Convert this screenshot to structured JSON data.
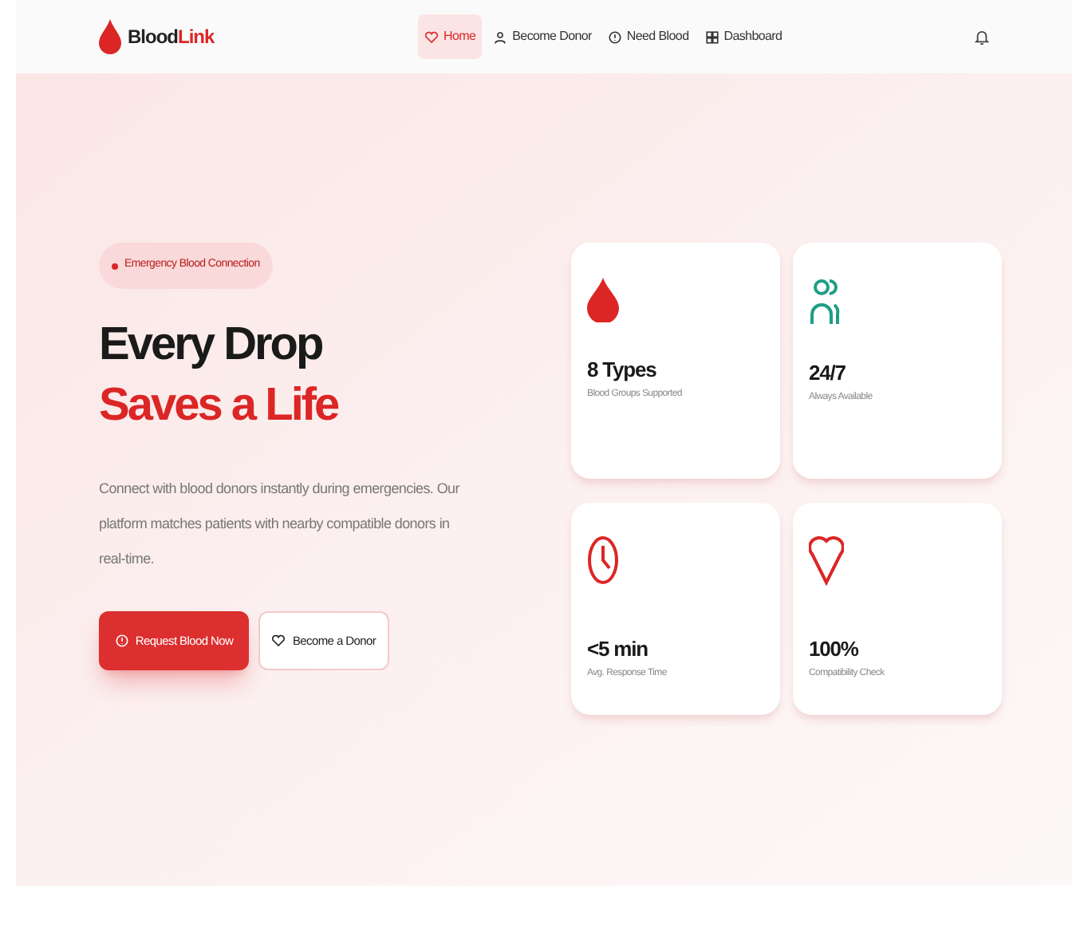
{
  "brand": {
    "primary": "Blood",
    "accent": "Link"
  },
  "nav": [
    {
      "label": "Home",
      "kind": "home",
      "selected": true
    },
    {
      "label": "Become Donor",
      "kind": "donor",
      "selected": false
    },
    {
      "label": "Need Blood",
      "kind": "request",
      "selected": false
    },
    {
      "label": "Dashboard",
      "kind": "dashboard",
      "selected": false
    }
  ],
  "hero": {
    "badge": "Emergency Blood Connection",
    "title_line_1": "Every Drop",
    "title_line_2": "Saves a Life",
    "description": "Connect with blood donors instantly during emergencies. Our platform matches patients with nearby compatible donors in real-time.",
    "buttons": [
      {
        "label": "Request Blood Now",
        "kind": "primary"
      },
      {
        "label": "Become a Donor",
        "kind": "secondary"
      }
    ]
  },
  "stats": [
    {
      "kind": "drop",
      "value": "8 Types",
      "caption": "Blood Groups Supported"
    },
    {
      "kind": "people",
      "value": "24/7",
      "caption": "Always Available"
    },
    {
      "kind": "clock",
      "value": "<5 min",
      "caption": "Avg. Response Time"
    },
    {
      "kind": "heart",
      "value": "100%",
      "caption": "Compatibility Check"
    }
  ]
}
